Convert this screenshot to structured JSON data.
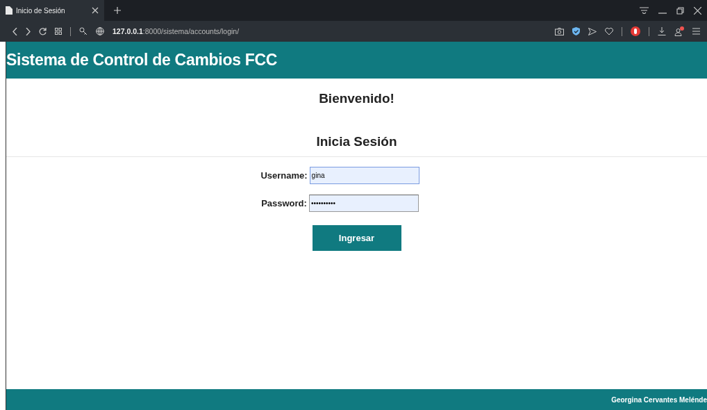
{
  "browser": {
    "tab": {
      "title": "Inicio de Sesión",
      "selected": true
    },
    "url_host": "127.0.0.1",
    "url_path": ":8000/sistema/accounts/login/"
  },
  "header": {
    "title": "Sistema de Control de Cambios FCC"
  },
  "welcome": "Bienvenido!",
  "form": {
    "heading": "Inicia Sesión",
    "fields": [
      {
        "label": "Username:",
        "value": "gina",
        "focused": true
      },
      {
        "label": "Password:",
        "value": "••••••••••",
        "focused": false
      }
    ],
    "submit": "Ingresar"
  },
  "footer": {
    "text": "Georgina Cervantes Melénde"
  }
}
